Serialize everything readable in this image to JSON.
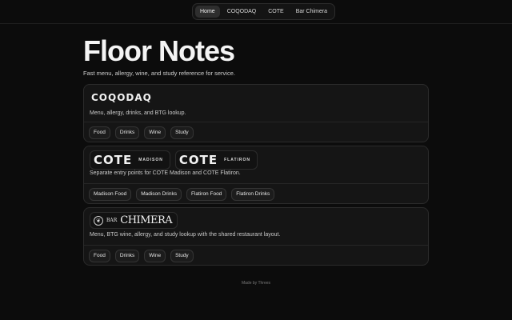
{
  "nav": {
    "items": [
      {
        "label": "Home",
        "active": true
      },
      {
        "label": "COQODAQ",
        "active": false
      },
      {
        "label": "COTE",
        "active": false
      },
      {
        "label": "Bar Chimera",
        "active": false
      }
    ]
  },
  "header": {
    "title": "Floor Notes",
    "subtitle": "Fast menu, allergy, wine, and study reference for service."
  },
  "cards": [
    {
      "logo": "COQODAQ",
      "description": "Menu, allergy, drinks, and BTG lookup.",
      "buttons": [
        "Food",
        "Drinks",
        "Wine",
        "Study"
      ]
    },
    {
      "logos": [
        {
          "word": "COTE",
          "location": "MADISON"
        },
        {
          "word": "COTE",
          "location": "FLATIRON"
        }
      ],
      "description": "Separate entry points for COTE Madison and COTE Flatiron.",
      "buttons": [
        "Madison Food",
        "Madison Drinks",
        "Flatiron Food",
        "Flatiron Drinks"
      ]
    },
    {
      "logo_bar": "BAR",
      "logo_name": "CHIMERA",
      "description": "Menu, BTG wine, allergy, and study lookup with the shared restaurant layout.",
      "buttons": [
        "Food",
        "Drinks",
        "Wine",
        "Study"
      ]
    }
  ],
  "footer": {
    "text": "Made by Threes"
  }
}
